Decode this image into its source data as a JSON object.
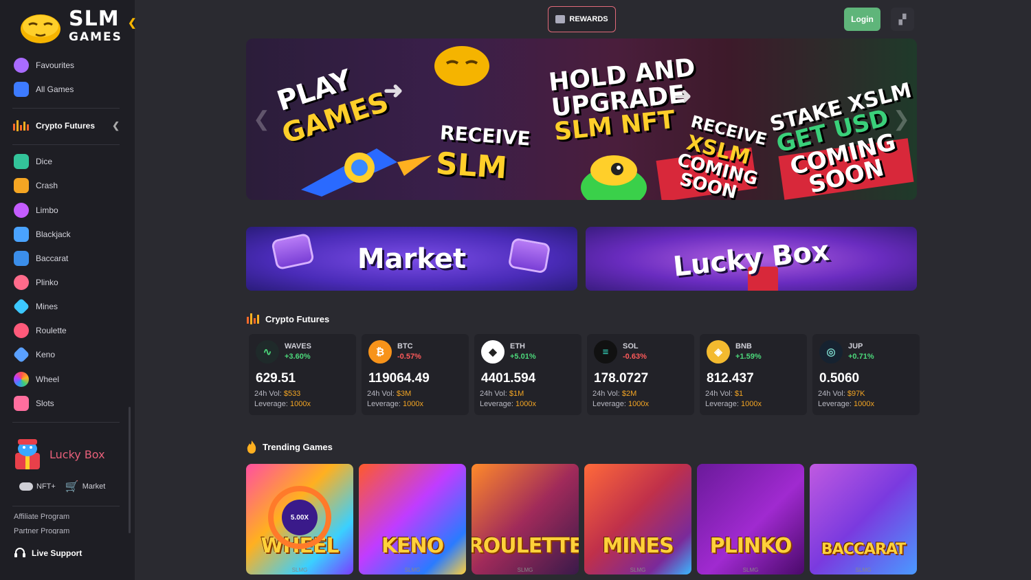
{
  "brand": {
    "line1": "SLM",
    "line2": "GAMES"
  },
  "sidebar": {
    "top_items": [
      {
        "label": "Favourites",
        "icon": "heart-face-icon",
        "color": "#a96bff"
      },
      {
        "label": "All Games",
        "icon": "grid-icon",
        "color": "#3d7bff"
      }
    ],
    "section_label": "Crypto Futures",
    "games": [
      {
        "label": "Dice",
        "icon": "dice-icon",
        "color": "#33c49a"
      },
      {
        "label": "Crash",
        "icon": "rocket-icon",
        "color": "#f5a623"
      },
      {
        "label": "Limbo",
        "icon": "planet-icon",
        "color": "#c45cff"
      },
      {
        "label": "Blackjack",
        "icon": "cards-icon",
        "color": "#4aa3ff"
      },
      {
        "label": "Baccarat",
        "icon": "card-icon",
        "color": "#3b8eea"
      },
      {
        "label": "Plinko",
        "icon": "balls-icon",
        "color": "#ff6b8b"
      },
      {
        "label": "Mines",
        "icon": "diamond-icon",
        "color": "#3cc8ff"
      },
      {
        "label": "Roulette",
        "icon": "roulette-icon",
        "color": "#ff5a7a"
      },
      {
        "label": "Keno",
        "icon": "keno-icon",
        "color": "#5aa0ff"
      },
      {
        "label": "Wheel",
        "icon": "wheel-icon",
        "color": "#ff8a3a"
      },
      {
        "label": "Slots",
        "icon": "slot-machine-icon",
        "color": "#ff6e9e"
      }
    ],
    "lucky_box": "Lucky Box",
    "nft_label": "NFT+",
    "market_label": "Market",
    "affiliate": "Affiliate Program",
    "partner": "Partner Program",
    "live_support": "Live Support"
  },
  "header": {
    "rewards": "REWARDS",
    "login": "Login"
  },
  "hero": {
    "play": "PLAY",
    "games": "GAMES",
    "receive": "RECEIVE",
    "slm": "SLM",
    "hold": "HOLD AND",
    "upgrade": "UPGRADE",
    "slm_nft": "SLM NFT",
    "receive2": "RECEIVE",
    "xslm": "XSLM",
    "coming": "COMING",
    "soon": "SOON",
    "stake": "STAKE XSLM",
    "get_usd": "GET USD",
    "coming2": "COMING",
    "soon2": "SOON"
  },
  "promos": {
    "market": "Market",
    "lucky": "Lucky Box"
  },
  "crypto_section": "Crypto Futures",
  "crypto": [
    {
      "sym": "WAVES",
      "chg": "+3.60%",
      "dir": "up",
      "price": "629.51",
      "vol": "$533",
      "lev": "1000x",
      "coin_bg": "#1f2a2a",
      "coin_fg": "#4cd97b",
      "glyph": "∿"
    },
    {
      "sym": "BTC",
      "chg": "-0.57%",
      "dir": "down",
      "price": "119064.49",
      "vol": "$3M",
      "lev": "1000x",
      "coin_bg": "#f7931a",
      "coin_fg": "#ffffff",
      "glyph": "₿"
    },
    {
      "sym": "ETH",
      "chg": "+5.01%",
      "dir": "up",
      "price": "4401.594",
      "vol": "$1M",
      "lev": "1000x",
      "coin_bg": "#ffffff",
      "coin_fg": "#222222",
      "glyph": "◆"
    },
    {
      "sym": "SOL",
      "chg": "-0.63%",
      "dir": "down",
      "price": "178.0727",
      "vol": "$2M",
      "lev": "1000x",
      "coin_bg": "#111111",
      "coin_fg": "#36e0c8",
      "glyph": "≡"
    },
    {
      "sym": "BNB",
      "chg": "+1.59%",
      "dir": "up",
      "price": "812.437",
      "vol": "$1",
      "lev": "1000x",
      "coin_bg": "#f3ba2f",
      "coin_fg": "#ffffff",
      "glyph": "◈"
    },
    {
      "sym": "JUP",
      "chg": "+0.71%",
      "dir": "up",
      "price": "0.5060",
      "vol": "$97K",
      "lev": "1000x",
      "coin_bg": "#162230",
      "coin_fg": "#7ad4c8",
      "glyph": "◎"
    }
  ],
  "vol_label": "24h Vol:",
  "lev_label": "Leverage:",
  "trending_section": "Trending Games",
  "games": [
    {
      "name": "WHEEL",
      "bg": "linear-gradient(135deg,#ff4fa0,#ffb020 40%,#3ad0ff 75%,#7a3cff)"
    },
    {
      "name": "KENO",
      "bg": "linear-gradient(135deg,#ff5a2a,#c03cff 45%,#2a7bff 80%,#ffcf3a)"
    },
    {
      "name": "ROULETTE",
      "bg": "linear-gradient(135deg,#ff8a2a,#a02a5a 50%,#3a1a4a)"
    },
    {
      "name": "MINES",
      "bg": "linear-gradient(135deg,#ff6a3a,#c0304a 45%,#7a2a9a 80%,#3ab8ff)"
    },
    {
      "name": "PLINKO",
      "bg": "linear-gradient(135deg,#6a1a9a,#a02ad0 55%,#4a0a6a)"
    },
    {
      "name": "BACCARAT",
      "bg": "linear-gradient(135deg,#c05ae0,#7a3adf 50%,#4a9aff)"
    }
  ],
  "wheel_multiplier": "5.00X",
  "tile_sub": "SLMG"
}
